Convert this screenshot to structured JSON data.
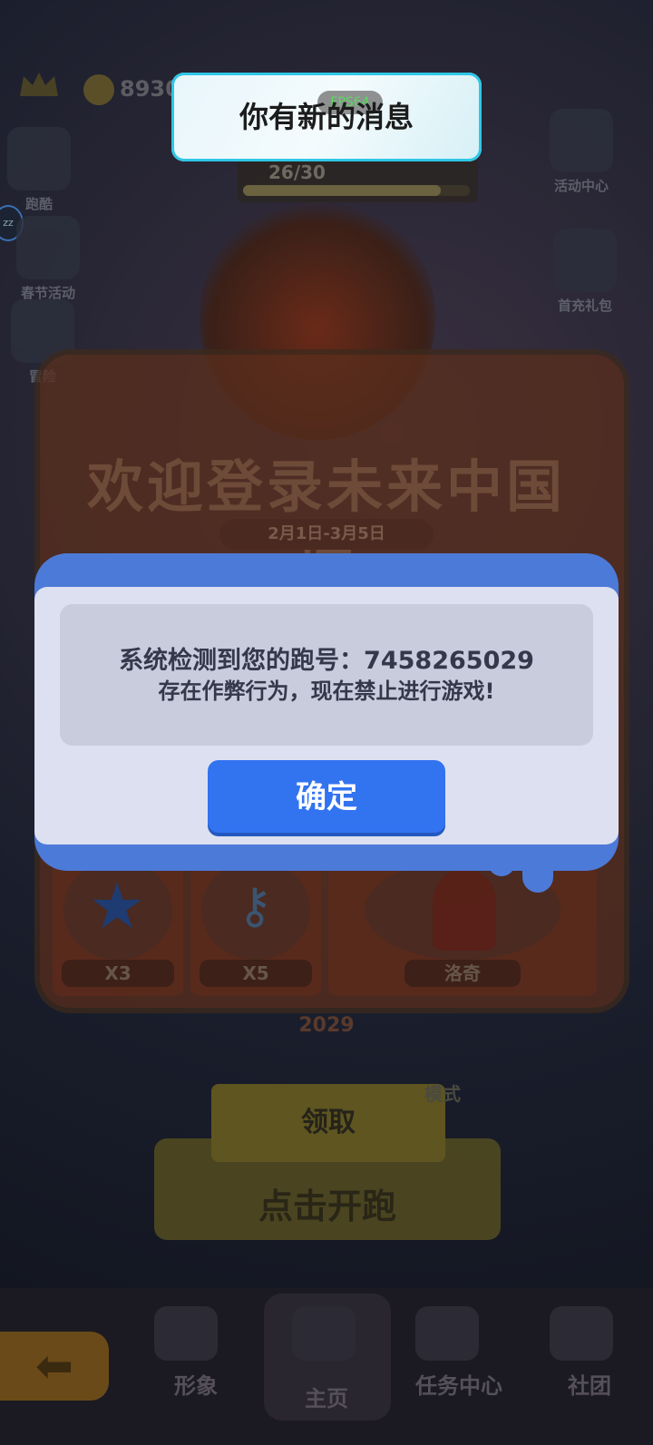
{
  "hud": {
    "coins": "8930"
  },
  "progress": {
    "text": "26/30",
    "fraction": 0.87
  },
  "sidebar": {
    "left": [
      {
        "label": "跑酷"
      },
      {
        "label": "春节活动"
      },
      {
        "label": "冒险"
      }
    ],
    "right": [
      {
        "label": "活动中心"
      },
      {
        "label": "首充礼包"
      }
    ]
  },
  "event": {
    "title": "欢迎登录未来中国城",
    "date_range": "2月1日-3月5日",
    "rewards": [
      {
        "label": "X3",
        "icon": "star-plus-icon"
      },
      {
        "label": "X5",
        "icon": "keys-icon"
      },
      {
        "label": "洛奇",
        "icon": "character-avatar"
      }
    ],
    "year": "2029"
  },
  "actions": {
    "claim": "领取",
    "start": "点击开跑",
    "mode": "模式"
  },
  "bottom_nav": {
    "items": [
      "形象",
      "主页",
      "任务中心",
      "社团"
    ]
  },
  "toast": {
    "message": "你有新的消息",
    "fps": "FPS64"
  },
  "modal": {
    "line1": "系统检测到您的跑号：7458265029",
    "line2": "存在作弊行为，现在禁止进行游戏!",
    "confirm": "确定"
  },
  "colors": {
    "modal_frame": "#4c7ad8",
    "confirm_button": "#3273f0",
    "toast_border": "#2fc7e6"
  }
}
